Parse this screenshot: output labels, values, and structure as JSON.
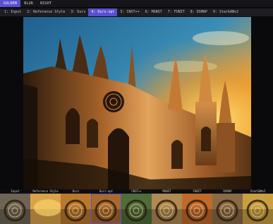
{
  "view_modes": [
    "GOLDEN",
    "BLUR",
    "NIGHT"
  ],
  "active_view_mode": 0,
  "method_tabs": [
    "1: Input",
    "2: Reference Style",
    "3: Ours",
    "4: Ours-opt",
    "5: CNST++",
    "6: MGNST",
    "7: FUNIT",
    "8: DSMAP",
    "9: StarGANv2"
  ],
  "active_method_tab": 3,
  "thumbnails": [
    {
      "label": "Input",
      "tint": "#6e6455"
    },
    {
      "label": "Reference Style",
      "tint": "#d9a24a"
    },
    {
      "label": "Ours",
      "tint": "#b9782e"
    },
    {
      "label": "Ours-opt",
      "tint": "#a86a2c"
    },
    {
      "label": "CNST++",
      "tint": "#4f6d3a"
    },
    {
      "label": "MGNST",
      "tint": "#b08a52"
    },
    {
      "label": "FUNIT",
      "tint": "#c06a2a"
    },
    {
      "label": "DSMAP",
      "tint": "#8a6a45"
    },
    {
      "label": "StarGANv2",
      "tint": "#c9a040"
    }
  ],
  "colors": {
    "accent": "#5a4fcf",
    "sky_top": "#2a6f9e",
    "sky_glow": "#f7b52b",
    "stone_light": "#e0a25c",
    "stone_dark": "#3a2412"
  }
}
